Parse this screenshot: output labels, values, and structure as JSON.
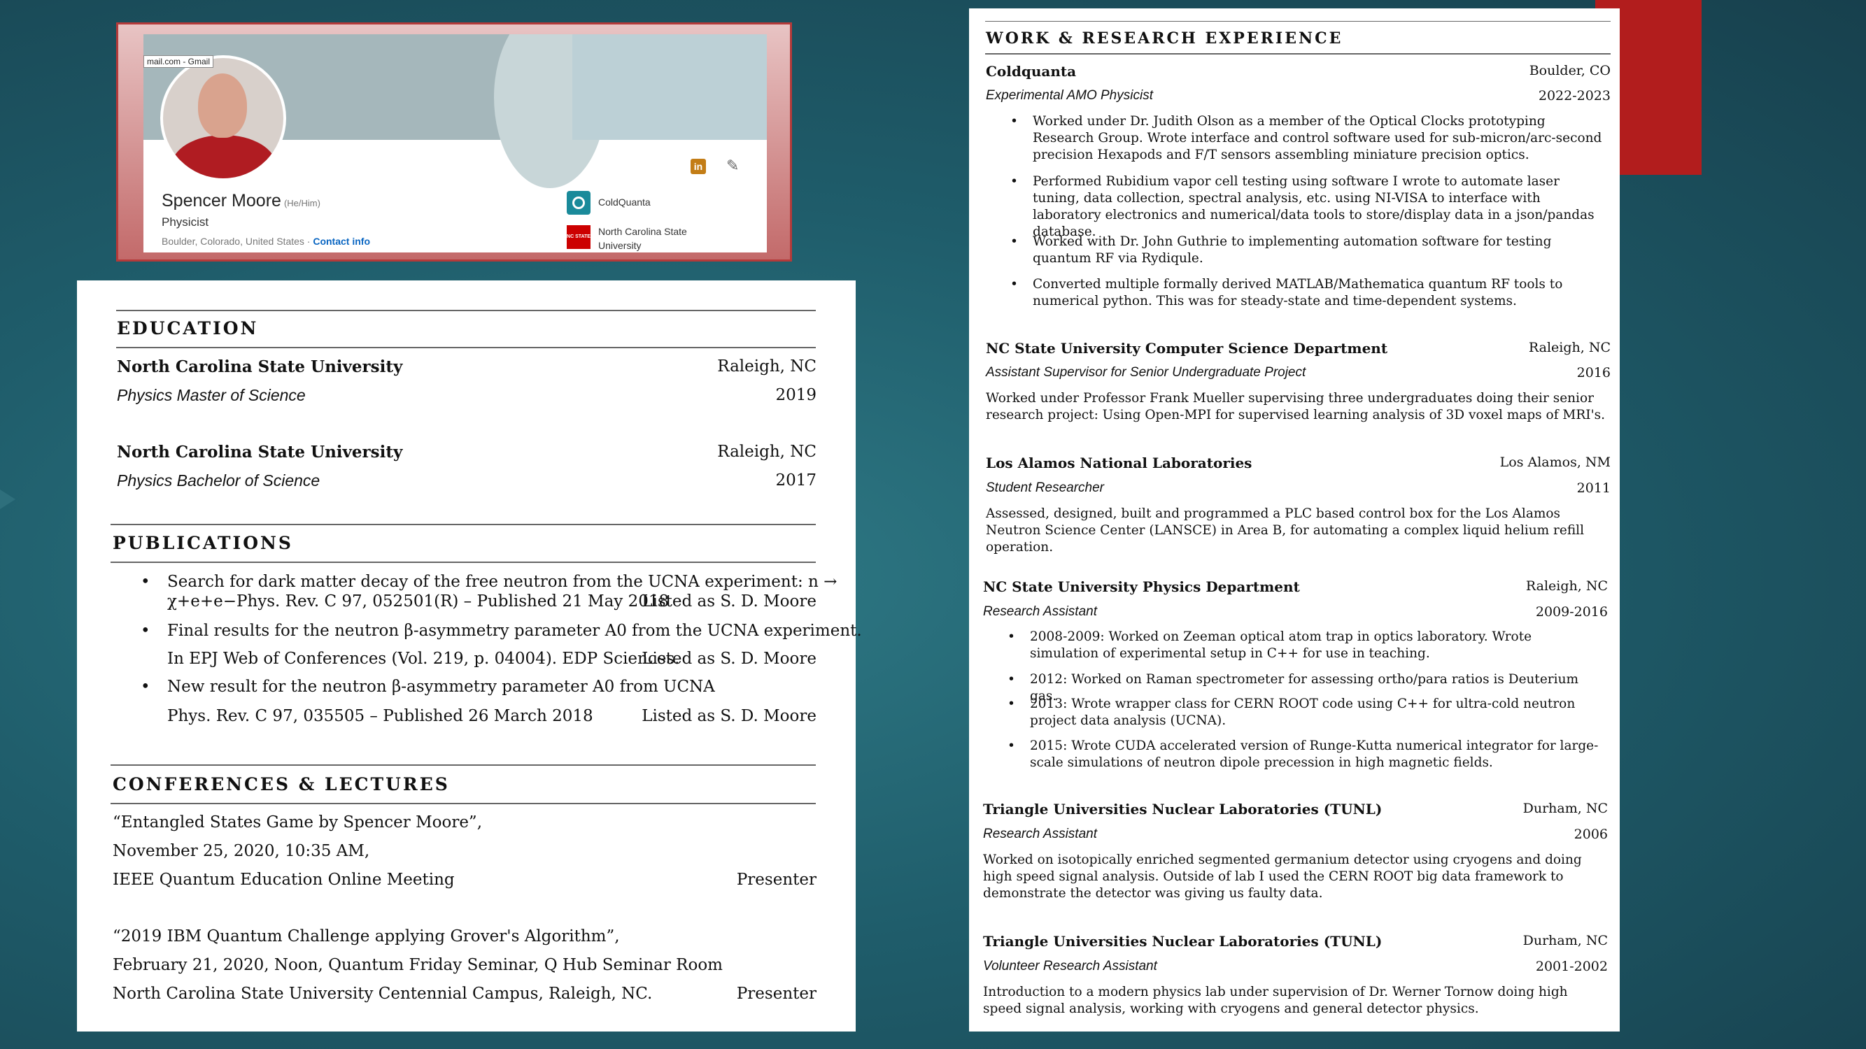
{
  "linkedin": {
    "gmail_tooltip": "mail.com - Gmail",
    "name": "Spencer Moore",
    "pronouns": "(He/Him)",
    "headline": "Physicist",
    "location": "Boulder, Colorado, United States · ",
    "contact_label": "Contact info",
    "linkedin_icon": "in",
    "edit_icon": "✎",
    "orgs": [
      {
        "name": "ColdQuanta",
        "logo_color": "#1a8a9a"
      },
      {
        "name_line1": "North Carolina State",
        "name_line2": "University",
        "logo_text": "NC STATE",
        "logo_color": "#cc0000"
      }
    ]
  },
  "education": {
    "title": "EDUCATION",
    "entries": [
      {
        "school": "North Carolina State University",
        "location": "Raleigh, NC",
        "degree": "Physics Master of Science",
        "year": "2019"
      },
      {
        "school": "North Carolina State University",
        "location": "Raleigh, NC",
        "degree": "Physics Bachelor of Science",
        "year": "2017"
      }
    ]
  },
  "publications": {
    "title": "PUBLICATIONS",
    "items": [
      {
        "line1": "Search for dark matter decay of the free neutron from the UCNA experiment: n →",
        "line2": "χ+e+e−Phys. Rev. C 97, 052501(R) – Published 21 May 2018",
        "note": "Listed as S. D. Moore"
      },
      {
        "line1": "Final results for the neutron β-asymmetry parameter A0 from the UCNA experiment.",
        "line2": "In EPJ Web of Conferences (Vol. 219, p. 04004). EDP Sciences.",
        "note": "Listed as S. D. Moore"
      },
      {
        "line1": "New result for the neutron β-asymmetry parameter A0 from UCNA",
        "line2": "Phys. Rev. C 97, 035505 – Published 26 March 2018",
        "note": "Listed as S. D. Moore"
      }
    ]
  },
  "conferences": {
    "title": "CONFERENCES & LECTURES",
    "items": [
      {
        "line1": "“Entangled States Game by Spencer Moore”,",
        "line2": "November 25, 2020, 10:35 AM,",
        "line3": "IEEE Quantum Education Online Meeting",
        "role": "Presenter"
      },
      {
        "line1": "“2019 IBM Quantum Challenge applying Grover's Algorithm”,",
        "line2": "February 21, 2020, Noon, Quantum Friday Seminar, Q Hub Seminar Room",
        "line3": "North Carolina State University Centennial Campus, Raleigh, NC.",
        "role": "Presenter"
      }
    ]
  },
  "work": {
    "title": "WORK & RESEARCH EXPERIENCE",
    "coldquanta": {
      "org": "Coldquanta",
      "location": "Boulder, CO",
      "role": "Experimental AMO Physicist",
      "years": "2022-2023",
      "bullets": [
        "Worked under Dr. Judith Olson as a member of the Optical Clocks prototyping Research Group. Wrote interface and control software used for sub-micron/arc-second precision Hexapods and F/T sensors assembling miniature precision optics.",
        "Performed Rubidium vapor cell testing using software I wrote to automate laser tuning, data collection, spectral analysis, etc. using NI-VISA to interface with laboratory electronics and numerical/data tools to store/display data in a json/pandas database.",
        "Worked with Dr. John Guthrie to implementing automation software for testing quantum RF via Rydiqule.",
        "Converted multiple formally derived MATLAB/Mathematica quantum RF tools to numerical python. This was for steady-state and time-dependent systems."
      ]
    },
    "ncsu_cs": {
      "org": "NC State University Computer Science Department",
      "location": "Raleigh, NC",
      "role": "Assistant Supervisor for Senior Undergraduate Project",
      "years": "2016",
      "desc": "Worked under Professor Frank Mueller supervising three undergraduates doing their senior research project: Using Open-MPI for supervised learning analysis of 3D voxel maps of MRI's."
    },
    "lanl": {
      "org": "Los Alamos National Laboratories",
      "location": "Los Alamos, NM",
      "role": "Student Researcher",
      "years": "2011",
      "desc": "Assessed, designed, built and programmed a PLC based control box for the Los Alamos Neutron Science Center (LANSCE) in Area B, for automating a complex liquid helium refill operation."
    },
    "ncsu_phys": {
      "org": "NC State University Physics Department",
      "location": "Raleigh, NC",
      "role": "Research Assistant",
      "years": "2009-2016",
      "bullets": [
        "2008-2009: Worked on Zeeman optical atom trap in optics laboratory.  Wrote simulation of experimental setup in C++ for use in teaching.",
        "2012: Worked on Raman spectrometer for assessing ortho/para ratios is Deuterium gas.",
        "2013: Wrote wrapper class for CERN ROOT code using C++ for ultra-cold neutron project data analysis (UCNA).",
        "2015: Wrote CUDA accelerated version of Runge-Kutta numerical integrator for large-scale simulations of neutron dipole precession in high magnetic fields."
      ]
    },
    "tunl1": {
      "org": "Triangle Universities Nuclear Laboratories (TUNL)",
      "location": "Durham, NC",
      "role": "Research Assistant",
      "years": "2006",
      "desc": "Worked on isotopically enriched segmented germanium detector using cryogens and doing high speed signal analysis.  Outside of lab I used the CERN ROOT big data framework to demonstrate the detector was giving us faulty data."
    },
    "tunl2": {
      "org": "Triangle Universities Nuclear Laboratories (TUNL)",
      "location": "Durham, NC",
      "role": "Volunteer Research Assistant",
      "years": "2001-2002",
      "desc": "Introduction to a modern physics lab under supervision of Dr. Werner Tornow doing high speed signal analysis, working with cryogens and general detector physics."
    }
  }
}
